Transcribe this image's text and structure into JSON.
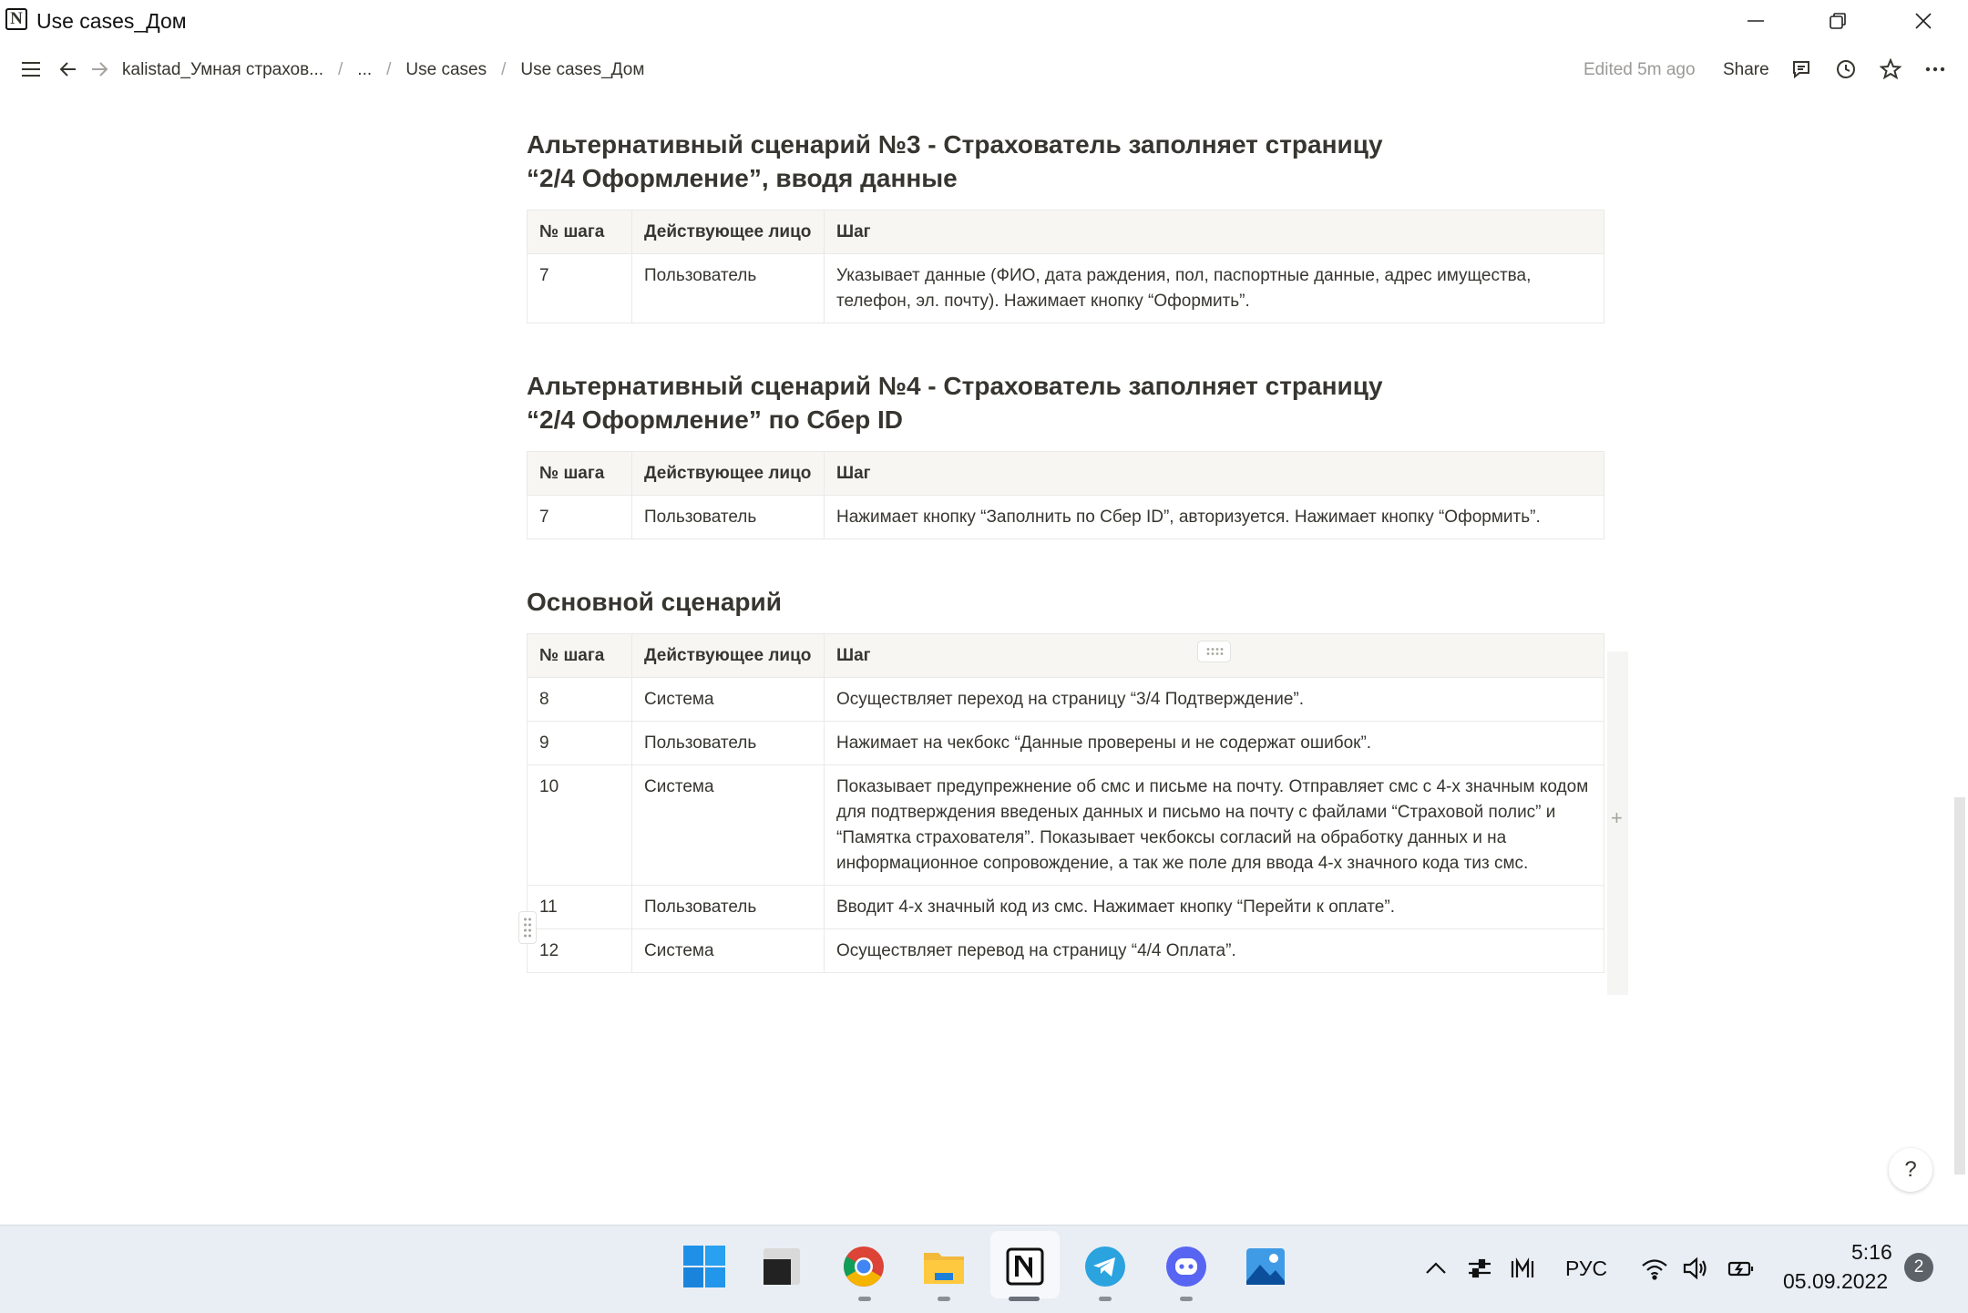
{
  "window": {
    "title": "Use cases_Дом",
    "logo_letter": "N"
  },
  "topbar": {
    "breadcrumbs": [
      "kalistad_Умная страхов...",
      "...",
      "Use cases",
      "Use cases_Дом"
    ],
    "separator": "/",
    "edited": "Edited 5m ago",
    "share": "Share"
  },
  "sections": [
    {
      "heading": "Альтернативный сценарий №3 - Страхователь заполняет страницу “2/4 Оформление”, вводя данные",
      "headers": [
        "№ шага",
        "Действующее лицо",
        "Шаг"
      ],
      "rows": [
        [
          "7",
          "Пользователь",
          "Указывает данные (ФИО, дата раждения, пол, паспортные данные, адрес имущества, телефон, эл. почту). Нажимает кнопку “Оформить”."
        ]
      ]
    },
    {
      "heading": "Альтернативный сценарий №4 - Страхователь заполняет страницу “2/4 Оформление” по Сбер ID",
      "headers": [
        "№ шага",
        "Действующее лицо",
        "Шаг"
      ],
      "rows": [
        [
          "7",
          "Пользователь",
          "Нажимает кнопку “Заполнить по Сбер ID”, авторизуется. Нажимает кнопку “Оформить”."
        ]
      ]
    },
    {
      "heading": "Основной сценарий",
      "headers": [
        "№ шага",
        "Действующее лицо",
        "Шаг"
      ],
      "rows": [
        [
          "8",
          "Система",
          "Осуществляет переход на страницу “3/4 Подтверждение”."
        ],
        [
          "9",
          "Пользователь",
          "Нажимает на чекбокс “Данные проверены и не содержат ошибок”."
        ],
        [
          "10",
          "Система",
          "Показывает предупрежнение об смс и письме на почту. Отправляет смс с 4-х значным кодом для подтверждения введеных данных и письмо на почту с файлами “Страховой полис” и “Памятка страхователя”. Показывает чекбоксы согласий на обработку данных и на информационное сопровождение, а так же поле для ввода 4-х значного кода тиз смс."
        ],
        [
          "11",
          "Пользователь",
          "Вводит 4-х значный код из смс. Нажимает кнопку “Перейти к оплате”."
        ],
        [
          "12",
          "Система",
          "Осуществляет перевод на страницу “4/4 Оплата”."
        ]
      ]
    }
  ],
  "help": "?",
  "add_column": "+",
  "taskbar": {
    "apps": [
      "start-icon",
      "terminal-icon",
      "chrome-icon",
      "file-explorer-icon",
      "notion-icon",
      "telegram-icon",
      "discord-icon",
      "photos-icon"
    ],
    "language": "РУС",
    "time": "5:16",
    "date": "05.09.2022",
    "notifications": "2"
  }
}
